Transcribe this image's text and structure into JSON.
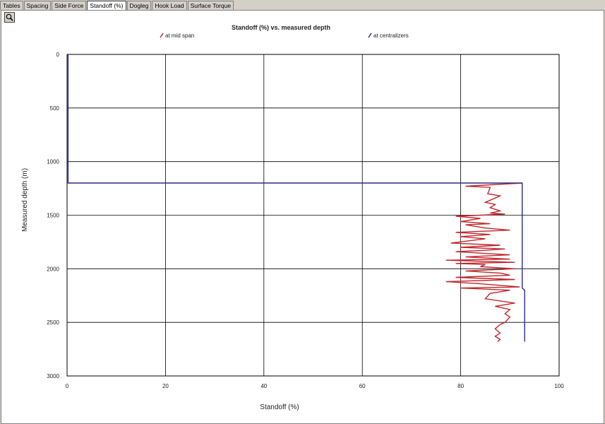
{
  "tabs": [
    {
      "label": "Tables",
      "active": false
    },
    {
      "label": "Spacing",
      "active": false
    },
    {
      "label": "Side Force",
      "active": false
    },
    {
      "label": "Standoff (%)",
      "active": true
    },
    {
      "label": "Dogleg",
      "active": false
    },
    {
      "label": "Hook Load",
      "active": false
    },
    {
      "label": "Surface Torque",
      "active": false
    }
  ],
  "toolbar": {
    "zoom_icon": "magnifier-icon"
  },
  "chart_data": {
    "type": "line",
    "title": "Standoff (%) vs. measured depth",
    "xlabel": "Standoff (%)",
    "ylabel": "Measured depth (m)",
    "xlim": [
      0,
      100
    ],
    "ylim": [
      0,
      3000
    ],
    "y_inverted": true,
    "x_ticks": [
      "0",
      "20",
      "40",
      "60",
      "80",
      "100"
    ],
    "y_ticks": [
      "0",
      "500",
      "1000",
      "1500",
      "2000",
      "2500",
      "3000"
    ],
    "grid": true,
    "legend_position": "top",
    "series": [
      {
        "name": "at mid span",
        "color": "#c0272d",
        "x": [
          92.5,
          81,
          86,
          85.5,
          88,
          85,
          87,
          86,
          88,
          86,
          89,
          79,
          84,
          80,
          86,
          81,
          85,
          90,
          79,
          86,
          80,
          85,
          78,
          88,
          80,
          89,
          84,
          79,
          86,
          90,
          81,
          90,
          77,
          91,
          79,
          85,
          84,
          91,
          81,
          88,
          90,
          79,
          91,
          77,
          84,
          92,
          80,
          90,
          86,
          85,
          91,
          87,
          90,
          89,
          90,
          89,
          88,
          87,
          88,
          87,
          88,
          87.5
        ],
        "y": [
          1200,
          1230,
          1240,
          1300,
          1320,
          1380,
          1400,
          1430,
          1460,
          1480,
          1490,
          1510,
          1530,
          1560,
          1580,
          1590,
          1620,
          1640,
          1660,
          1680,
          1700,
          1720,
          1760,
          1780,
          1800,
          1815,
          1830,
          1840,
          1860,
          1870,
          1890,
          1910,
          1920,
          1940,
          1950,
          1960,
          1980,
          2000,
          2020,
          2040,
          2060,
          2080,
          2100,
          2120,
          2140,
          2170,
          2180,
          2200,
          2230,
          2280,
          2320,
          2350,
          2380,
          2420,
          2450,
          2500,
          2520,
          2560,
          2600,
          2630,
          2660,
          2680
        ]
      },
      {
        "name": "at centralizers",
        "color": "#2b2c8c",
        "x": [
          0.2,
          0.2,
          92.5,
          92.5,
          93,
          93
        ],
        "y": [
          0,
          1200,
          1200,
          2180,
          2200,
          2680
        ]
      }
    ]
  }
}
